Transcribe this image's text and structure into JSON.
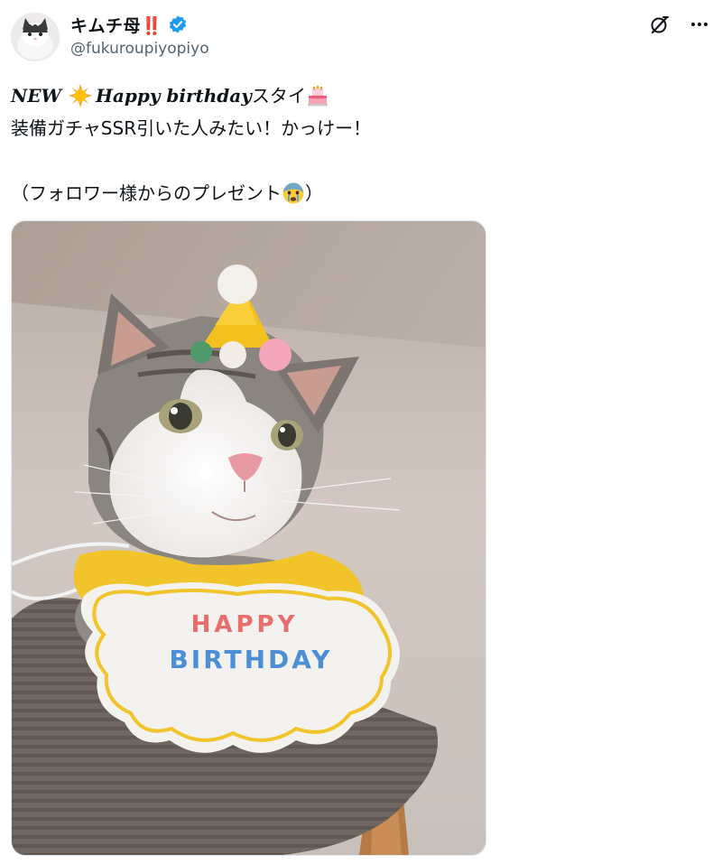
{
  "author": {
    "display_name": "キムチ母‼️",
    "handle": "@fukuroupiyopiyo",
    "verified": true
  },
  "post": {
    "line1_new": "NEW",
    "line1_happy": "Happy birthday",
    "line1_tail": "スタイ",
    "line2": "装備ガチャSSR引いた人みたい！かっけー！",
    "line3_text": "（フォロワー様からのプレゼント",
    "line3_close": "）"
  },
  "media": {
    "bib_text_line1": "HAPPY",
    "bib_text_line2": "BIRTHDAY"
  },
  "icons": [
    "verified-badge-icon",
    "grok-icon",
    "more-icon",
    "sun-emoji-icon",
    "birthday-cake-emoji-icon",
    "crying-emoji-icon"
  ],
  "colors": {
    "verified": "#1d9bf0",
    "text": "#0f1419",
    "secondary": "#536471"
  }
}
